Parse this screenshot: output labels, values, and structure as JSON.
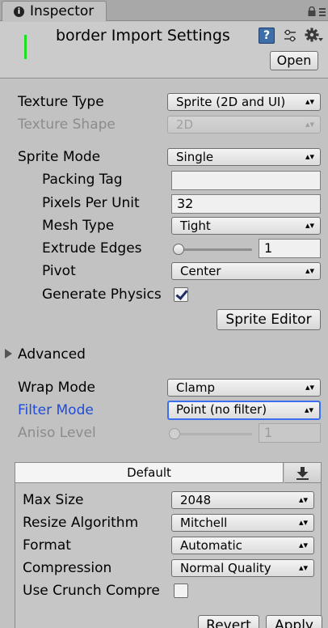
{
  "tab": {
    "label": "Inspector",
    "icon": "info-icon"
  },
  "header": {
    "title": "border Import Settings",
    "open_button": "Open"
  },
  "settings": {
    "texture_type": {
      "label": "Texture Type",
      "value": "Sprite (2D and UI)"
    },
    "texture_shape": {
      "label": "Texture Shape",
      "value": "2D"
    },
    "sprite_mode": {
      "label": "Sprite Mode",
      "value": "Single"
    },
    "packing_tag": {
      "label": "Packing Tag",
      "value": ""
    },
    "pixels_per_unit": {
      "label": "Pixels Per Unit",
      "value": "32"
    },
    "mesh_type": {
      "label": "Mesh Type",
      "value": "Tight"
    },
    "extrude_edges": {
      "label": "Extrude Edges",
      "value": "1",
      "slider_fraction": 0.03
    },
    "pivot": {
      "label": "Pivot",
      "value": "Center"
    },
    "generate_physics": {
      "label": "Generate Physics",
      "checked": true
    },
    "sprite_editor_button": "Sprite Editor",
    "advanced": {
      "label": "Advanced",
      "expanded": false
    },
    "wrap_mode": {
      "label": "Wrap Mode",
      "value": "Clamp"
    },
    "filter_mode": {
      "label": "Filter Mode",
      "value": "Point (no filter)"
    },
    "aniso_level": {
      "label": "Aniso Level",
      "value": "1",
      "slider_fraction": 0.0
    }
  },
  "platform": {
    "tab_label": "Default",
    "max_size": {
      "label": "Max Size",
      "value": "2048"
    },
    "resize_algorithm": {
      "label": "Resize Algorithm",
      "value": "Mitchell"
    },
    "format": {
      "label": "Format",
      "value": "Automatic"
    },
    "compression": {
      "label": "Compression",
      "value": "Normal Quality"
    },
    "use_crunch": {
      "label": "Use Crunch Compre",
      "checked": false
    }
  },
  "footer": {
    "revert_button": "Revert",
    "apply_button": "Apply"
  },
  "colors": {
    "accent": "#3d6ef0",
    "label_highlight": "#1f4bd8",
    "green_bar": "#1ee01e"
  }
}
